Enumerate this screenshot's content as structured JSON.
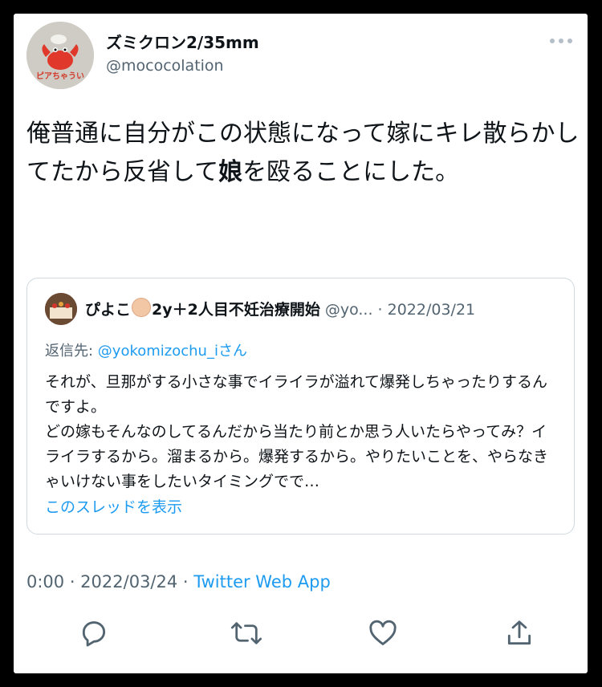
{
  "author": {
    "display_name": "ズミクロン2/35mm",
    "handle": "@mococolation",
    "avatar_text": "ピアちゃうい"
  },
  "tweet": {
    "text_before": "俺普通に自分がこの状態になって嫁にキレ散らかしてたから反省して",
    "text_bold": "娘",
    "text_after": "を殴ることにした。"
  },
  "quote": {
    "name": "ぴよこ",
    "name_suffix": "2y＋2人目不妊治療開始",
    "handle_date": "@yo... · 2022/03/21",
    "reply_prefix": "返信先: ",
    "reply_handle": "@yokomizochu_iさん",
    "body": "それが、旦那がする小さな事でイライラが溢れて爆発しちゃったりするんですよ。\nどの嫁もそんなのしてるんだから当たり前とか思う人いたらやってみ？イライラするから。溜まるから。爆発するから。やりたいことを、やらなきゃいけない事をしたいタイミングでで…",
    "show_thread": "このスレッドを表示"
  },
  "meta": {
    "time_date": "0:00 · 2022/03/24 · ",
    "source": "Twitter Web App"
  },
  "icons": [
    "more-icon",
    "reply-icon",
    "retweet-icon",
    "like-icon",
    "share-icon"
  ],
  "colors": {
    "link": "#1d9bf0",
    "secondary": "#536471",
    "icon": "#536471"
  }
}
